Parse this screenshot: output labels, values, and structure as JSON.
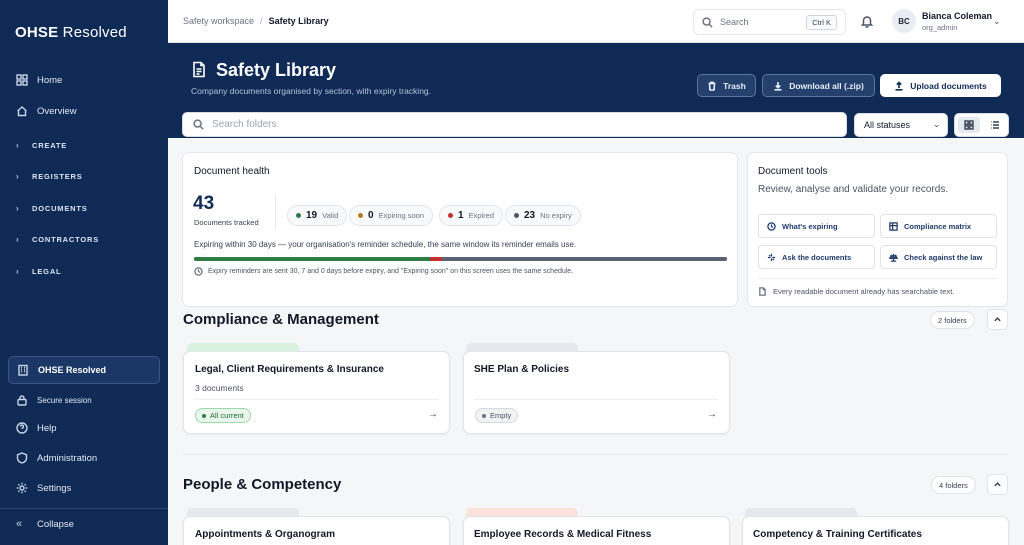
{
  "brand": {
    "strong": "OHSE",
    "light": " Resolved"
  },
  "sidebar": {
    "top_items": [
      {
        "label": "Home",
        "icon": "grid-icon"
      },
      {
        "label": "Overview",
        "icon": "home-icon"
      }
    ],
    "groups": [
      "CREATE",
      "REGISTERS",
      "DOCUMENTS",
      "CONTRACTORS",
      "LEGAL"
    ],
    "org_label": "OHSE Resolved",
    "bottom_items": [
      {
        "label": "Secure session",
        "icon": "lock-icon"
      },
      {
        "label": "Help",
        "icon": "help-icon"
      },
      {
        "label": "Administration",
        "icon": "shield-icon"
      },
      {
        "label": "Settings",
        "icon": "gear-icon"
      }
    ],
    "collapse_label": "Collapse"
  },
  "topbar": {
    "breadcrumb": [
      "Safety workspace",
      "Safety Library"
    ],
    "search_placeholder": "Search",
    "search_shortcut": "Ctrl K",
    "user": {
      "initials": "BC",
      "name": "Bianca Coleman",
      "role": "org_admin"
    }
  },
  "header": {
    "title": "Safety Library",
    "subtitle": "Company documents organised by section, with expiry tracking.",
    "buttons": {
      "trash": "Trash",
      "download": "Download all (.zip)",
      "upload": "Upload documents"
    }
  },
  "filters": {
    "search_placeholder": "Search folders",
    "status_value": "All statuses",
    "view_mode": "grid"
  },
  "document_health": {
    "title": "Document health",
    "total": "43",
    "total_label": "Documents tracked",
    "stats": [
      {
        "count": "19",
        "label": "Valid",
        "color": "#2e7d45"
      },
      {
        "count": "0",
        "label": "Expiring soon",
        "color": "#b7791f"
      },
      {
        "count": "1",
        "label": "Expired",
        "color": "#c53030"
      },
      {
        "count": "23",
        "label": "No expiry",
        "color": "#4b5563"
      }
    ],
    "note": "Expiring within 30 days — your organisation's reminder schedule, the same window its reminder emails use.",
    "footnote": "Expiry reminders are sent 30, 7 and 0 days before expiry, and \"Expiring soon\" on this screen uses the same schedule.",
    "bar_fractions": {
      "valid": 0.442,
      "expiring": 0.0,
      "expired": 0.023,
      "no_expiry": 0.535
    }
  },
  "document_tools": {
    "title": "Document tools",
    "subtitle": "Review, analyse and validate your records.",
    "tools": [
      {
        "label": "What's expiring",
        "icon": "clock-icon"
      },
      {
        "label": "Compliance matrix",
        "icon": "table-icon"
      },
      {
        "label": "Ask the documents",
        "icon": "sparkle-icon"
      },
      {
        "label": "Check against the law",
        "icon": "scale-icon"
      }
    ],
    "footnote": "Every readable document already has searchable text."
  },
  "sections": [
    {
      "title": "Compliance & Management",
      "count_label": "2 folders",
      "folders": [
        {
          "name": "Legal, Client Requirements & Insurance",
          "docs": "3 documents",
          "badge": "All current",
          "status": "ok",
          "tab_color": "#d9f2df"
        },
        {
          "name": "SHE Plan & Policies",
          "docs": "",
          "badge": "Empty",
          "status": "empty",
          "tab_color": "#e6e8ec"
        }
      ]
    },
    {
      "title": "People & Competency",
      "count_label": "4 folders",
      "folders": [
        {
          "name": "Appointments & Organogram",
          "tab_color": "#e6e8ec"
        },
        {
          "name": "Employee Records & Medical Fitness",
          "tab_color": "#fbe3dc"
        },
        {
          "name": "Competency & Training Certificates",
          "tab_color": "#e6e8ec"
        }
      ]
    }
  ]
}
